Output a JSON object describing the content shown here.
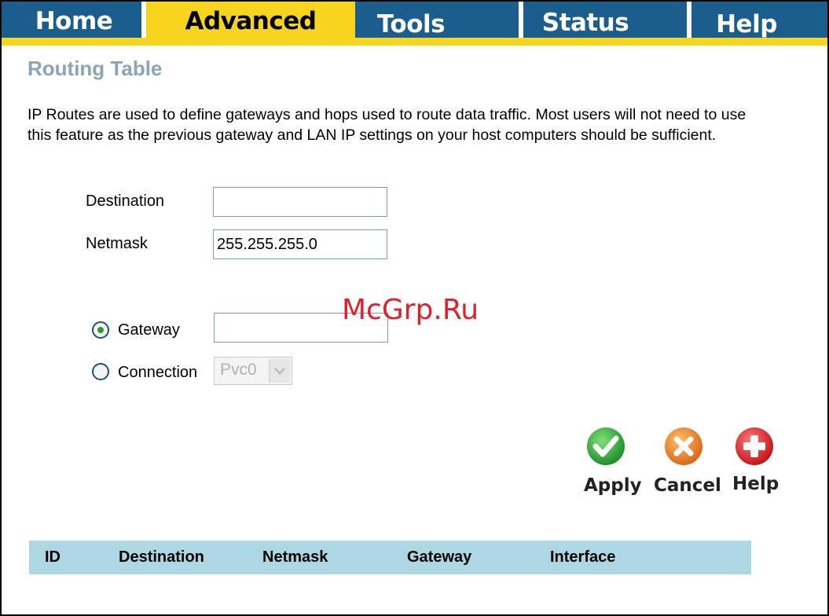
{
  "tabs": [
    {
      "label": "Home",
      "active": false
    },
    {
      "label": "Advanced",
      "active": true
    },
    {
      "label": "Tools",
      "active": false
    },
    {
      "label": "Status",
      "active": false
    },
    {
      "label": "Help",
      "active": false
    }
  ],
  "page": {
    "title": "Routing Table",
    "description": "IP Routes are used to define gateways and hops used to route data traffic. Most users will not need to use this feature as the previous gateway and LAN IP settings on your host computers should be sufficient."
  },
  "form": {
    "destination_label": "Destination",
    "destination_value": "",
    "netmask_label": "Netmask",
    "netmask_value": "255.255.255.0",
    "gateway_label": "Gateway",
    "gateway_value": "",
    "gateway_selected": true,
    "connection_label": "Connection",
    "connection_selected": false,
    "connection_value": "Pvc0"
  },
  "actions": {
    "apply_label": "Apply",
    "cancel_label": "Cancel",
    "help_label": "Help"
  },
  "table": {
    "headers": [
      "ID",
      "Destination",
      "Netmask",
      "Gateway",
      "Interface"
    ]
  },
  "watermark": "McGrp.Ru",
  "colors": {
    "tab_bar": "#1b5d8c",
    "tab_active": "#f7d51f",
    "title": "#8aa6b4",
    "table_header": "#add8e3"
  }
}
